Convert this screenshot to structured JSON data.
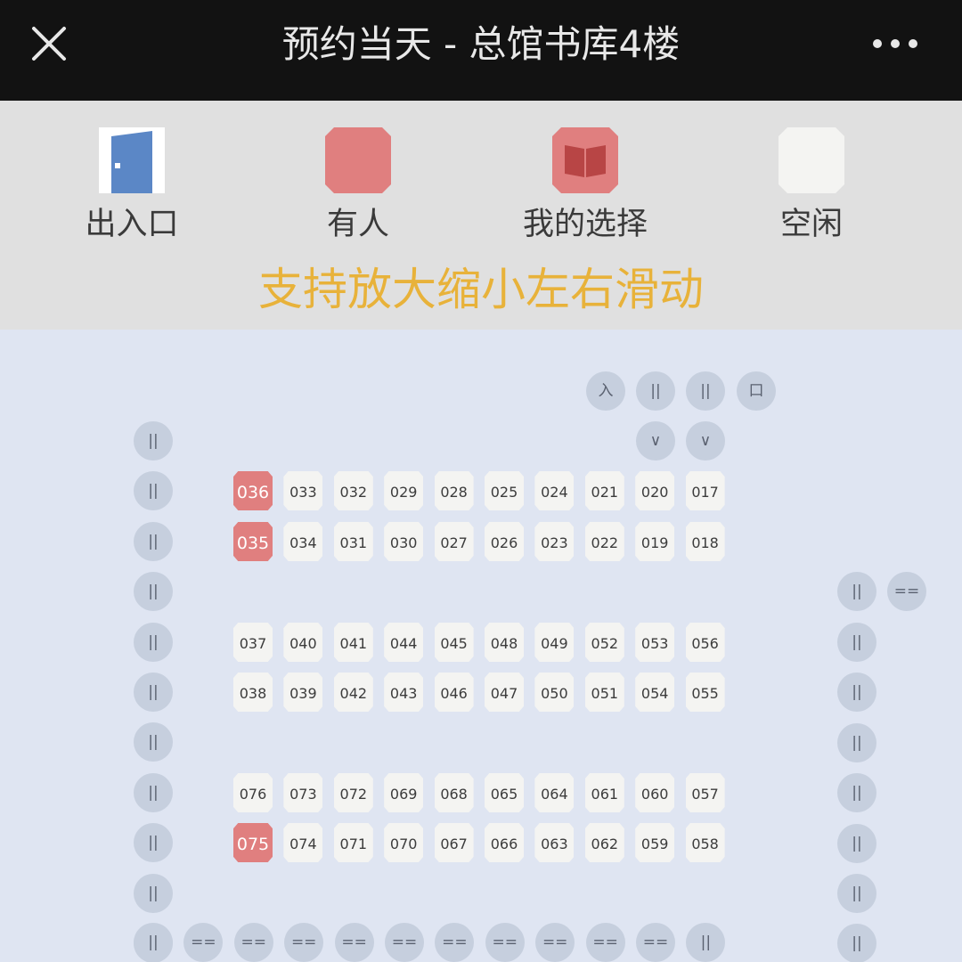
{
  "header": {
    "title": "预约当天 - 总馆书库4楼"
  },
  "legend": {
    "entrance": "出入口",
    "occupied": "有人",
    "selected": "我的选择",
    "free": "空闲"
  },
  "hint": "支持放大缩小左右滑动",
  "colors": {
    "header_bg": "#121212",
    "legend_bg": "#e0e0e0",
    "map_bg": "#dfe5f2",
    "occupied": "#e07f7f",
    "free": "#f4f4f2",
    "marker": "#c6cfde",
    "hint": "#e8b23a",
    "entrance": "#5b87c6"
  },
  "markers": {
    "entrance_row": [
      "入",
      "||",
      "||",
      "口"
    ],
    "down_arrows": [
      "∨",
      "∨"
    ],
    "left_column": [
      "||",
      "||",
      "||",
      "||",
      "||",
      "||",
      "||",
      "||",
      "||",
      "||",
      "||"
    ],
    "right_top": [
      "||",
      "=="
    ],
    "right_column": [
      "||",
      "||",
      "||",
      "||",
      "||",
      "||",
      "||"
    ],
    "bottom_row": [
      "||",
      "==",
      "==",
      "==",
      "==",
      "==",
      "==",
      "==",
      "==",
      "==",
      "==",
      "||"
    ]
  },
  "seat_rows": [
    [
      {
        "n": "036",
        "s": "occupied"
      },
      {
        "n": "033",
        "s": "free"
      },
      {
        "n": "032",
        "s": "free"
      },
      {
        "n": "029",
        "s": "free"
      },
      {
        "n": "028",
        "s": "free"
      },
      {
        "n": "025",
        "s": "free"
      },
      {
        "n": "024",
        "s": "free"
      },
      {
        "n": "021",
        "s": "free"
      },
      {
        "n": "020",
        "s": "free"
      },
      {
        "n": "017",
        "s": "free"
      }
    ],
    [
      {
        "n": "035",
        "s": "occupied"
      },
      {
        "n": "034",
        "s": "free"
      },
      {
        "n": "031",
        "s": "free"
      },
      {
        "n": "030",
        "s": "free"
      },
      {
        "n": "027",
        "s": "free"
      },
      {
        "n": "026",
        "s": "free"
      },
      {
        "n": "023",
        "s": "free"
      },
      {
        "n": "022",
        "s": "free"
      },
      {
        "n": "019",
        "s": "free"
      },
      {
        "n": "018",
        "s": "free"
      }
    ],
    [
      {
        "n": "037",
        "s": "free"
      },
      {
        "n": "040",
        "s": "free"
      },
      {
        "n": "041",
        "s": "free"
      },
      {
        "n": "044",
        "s": "free"
      },
      {
        "n": "045",
        "s": "free"
      },
      {
        "n": "048",
        "s": "free"
      },
      {
        "n": "049",
        "s": "free"
      },
      {
        "n": "052",
        "s": "free"
      },
      {
        "n": "053",
        "s": "free"
      },
      {
        "n": "056",
        "s": "free"
      }
    ],
    [
      {
        "n": "038",
        "s": "free"
      },
      {
        "n": "039",
        "s": "free"
      },
      {
        "n": "042",
        "s": "free"
      },
      {
        "n": "043",
        "s": "free"
      },
      {
        "n": "046",
        "s": "free"
      },
      {
        "n": "047",
        "s": "free"
      },
      {
        "n": "050",
        "s": "free"
      },
      {
        "n": "051",
        "s": "free"
      },
      {
        "n": "054",
        "s": "free"
      },
      {
        "n": "055",
        "s": "free"
      }
    ],
    [
      {
        "n": "076",
        "s": "free"
      },
      {
        "n": "073",
        "s": "free"
      },
      {
        "n": "072",
        "s": "free"
      },
      {
        "n": "069",
        "s": "free"
      },
      {
        "n": "068",
        "s": "free"
      },
      {
        "n": "065",
        "s": "free"
      },
      {
        "n": "064",
        "s": "free"
      },
      {
        "n": "061",
        "s": "free"
      },
      {
        "n": "060",
        "s": "free"
      },
      {
        "n": "057",
        "s": "free"
      }
    ],
    [
      {
        "n": "075",
        "s": "occupied"
      },
      {
        "n": "074",
        "s": "free"
      },
      {
        "n": "071",
        "s": "free"
      },
      {
        "n": "070",
        "s": "free"
      },
      {
        "n": "067",
        "s": "free"
      },
      {
        "n": "066",
        "s": "free"
      },
      {
        "n": "063",
        "s": "free"
      },
      {
        "n": "062",
        "s": "free"
      },
      {
        "n": "059",
        "s": "free"
      },
      {
        "n": "058",
        "s": "free"
      }
    ]
  ]
}
